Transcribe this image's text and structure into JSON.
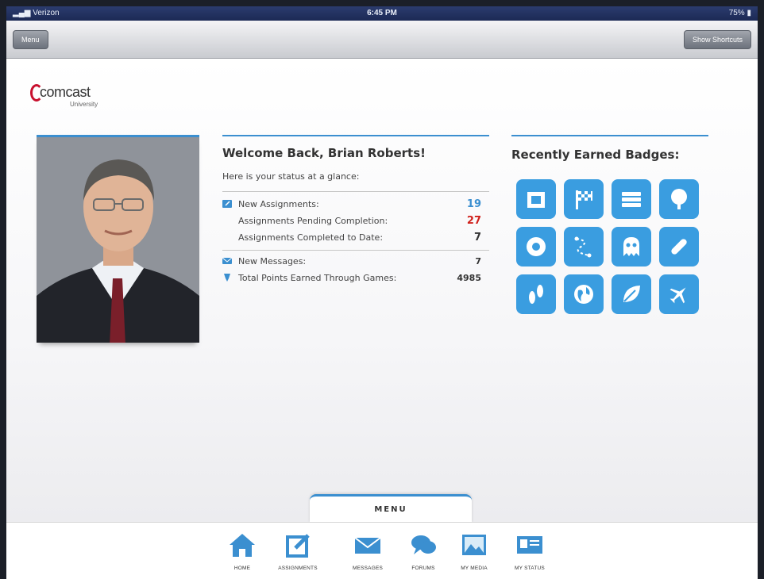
{
  "status_bar": {
    "carrier": "Verizon",
    "time": "6:45 PM",
    "battery": "75%"
  },
  "toolbar": {
    "menu_label": "Menu",
    "shortcuts_label": "Show Shortcuts"
  },
  "logo": {
    "brand": "comcast",
    "sub": "University"
  },
  "welcome": {
    "title": "Welcome Back, Brian Roberts!",
    "subtitle": "Here is your status at a glance:"
  },
  "stats": {
    "new_assignments": {
      "label": "New Assignments:",
      "value": "19",
      "color": "#3b8fd0"
    },
    "pending": {
      "label": "Assignments Pending Completion:",
      "value": "27",
      "color": "#d0211c"
    },
    "completed": {
      "label": "Assignments Completed to Date:",
      "value": "7",
      "color": "#333333"
    },
    "messages": {
      "label": "New Messages:",
      "value": "7"
    },
    "points": {
      "label": "Total Points Earned Through Games:",
      "value": "4985"
    }
  },
  "badges": {
    "title": "Recently Earned Badges:",
    "items": [
      {
        "icon": "recycle-icon"
      },
      {
        "icon": "checkered-flag-icon"
      },
      {
        "icon": "books-icon"
      },
      {
        "icon": "tree-icon"
      },
      {
        "icon": "life-preserver-icon"
      },
      {
        "icon": "path-icon"
      },
      {
        "icon": "ghost-icon"
      },
      {
        "icon": "bandage-icon"
      },
      {
        "icon": "footprints-icon"
      },
      {
        "icon": "globe-icon"
      },
      {
        "icon": "leaf-icon"
      },
      {
        "icon": "airplane-icon"
      }
    ]
  },
  "menu": {
    "tab_label": "MENU",
    "items": [
      {
        "label": "HOME",
        "icon": "home-icon"
      },
      {
        "label": "ASSIGNMENTS",
        "icon": "edit-icon"
      },
      {
        "label": "MESSAGES",
        "icon": "envelope-icon"
      },
      {
        "label": "FORUMS",
        "icon": "chat-bubbles-icon"
      },
      {
        "label": "MY MEDIA",
        "icon": "image-icon"
      },
      {
        "label": "MY STATUS",
        "icon": "id-card-icon"
      }
    ]
  },
  "colors": {
    "accent": "#3b8fd0",
    "badge": "#3a9de0",
    "alert": "#d0211c",
    "brand": "#c8102e"
  }
}
